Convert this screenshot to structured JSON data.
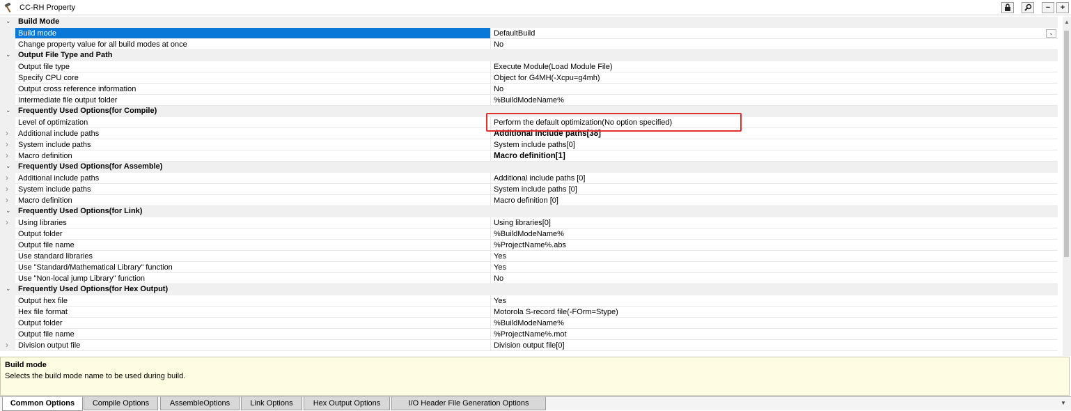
{
  "window": {
    "title": "CC-RH Property",
    "buttons": [
      "lock-icon",
      "search-icon",
      "minus-icon",
      "plus-icon"
    ]
  },
  "rows": [
    {
      "type": "category",
      "label": "Build Mode"
    },
    {
      "type": "property",
      "name": "Build mode",
      "value": "DefaultBuild",
      "selected": true,
      "dropdown": true
    },
    {
      "type": "property",
      "name": "Change property value for all build modes at once",
      "value": "No"
    },
    {
      "type": "category",
      "label": "Output File Type and Path"
    },
    {
      "type": "property",
      "name": "Output file type",
      "value": "Execute Module(Load Module File)"
    },
    {
      "type": "property",
      "name": "Specify CPU core",
      "value": "Object for G4MH(-Xcpu=g4mh)"
    },
    {
      "type": "property",
      "name": "Output cross reference information",
      "value": "No"
    },
    {
      "type": "property",
      "name": "Intermediate file output folder",
      "value": "%BuildModeName%"
    },
    {
      "type": "category",
      "label": "Frequently Used Options(for Compile)"
    },
    {
      "type": "property",
      "name": "Level of optimization",
      "value": "Perform the default optimization(No option specified)",
      "highlighted": true
    },
    {
      "type": "property",
      "name": "Additional include paths",
      "value": "Additional include paths[38]",
      "expandable": true,
      "bold": true
    },
    {
      "type": "property",
      "name": "System include paths",
      "value": "System include paths[0]",
      "expandable": true
    },
    {
      "type": "property",
      "name": "Macro definition",
      "value": "Macro definition[1]",
      "expandable": true,
      "bold": true
    },
    {
      "type": "category",
      "label": "Frequently Used Options(for Assemble)"
    },
    {
      "type": "property",
      "name": "Additional include paths",
      "value": "Additional include paths [0]",
      "expandable": true
    },
    {
      "type": "property",
      "name": "System include paths",
      "value": "System include paths [0]",
      "expandable": true
    },
    {
      "type": "property",
      "name": "Macro definition",
      "value": "Macro definition [0]",
      "expandable": true
    },
    {
      "type": "category",
      "label": "Frequently Used Options(for Link)"
    },
    {
      "type": "property",
      "name": "Using libraries",
      "value": "Using libraries[0]",
      "expandable": true
    },
    {
      "type": "property",
      "name": "Output folder",
      "value": "%BuildModeName%"
    },
    {
      "type": "property",
      "name": "Output file name",
      "value": "%ProjectName%.abs"
    },
    {
      "type": "property",
      "name": "Use standard libraries",
      "value": "Yes"
    },
    {
      "type": "property",
      "name": "Use \"Standard/Mathematical Library\" function",
      "value": "Yes"
    },
    {
      "type": "property",
      "name": "Use \"Non-local jump Library\" function",
      "value": "No"
    },
    {
      "type": "category",
      "label": "Frequently Used Options(for Hex Output)"
    },
    {
      "type": "property",
      "name": "Output hex file",
      "value": "Yes"
    },
    {
      "type": "property",
      "name": "Hex file format",
      "value": "Motorola S-record file(-FOrm=Stype)"
    },
    {
      "type": "property",
      "name": "Output folder",
      "value": "%BuildModeName%"
    },
    {
      "type": "property",
      "name": "Output file name",
      "value": "%ProjectName%.mot"
    },
    {
      "type": "property",
      "name": "Division output file",
      "value": "Division output file[0]",
      "expandable": true
    }
  ],
  "description": {
    "title": "Build mode",
    "text": "Selects the build mode name to be used during build."
  },
  "tabs": [
    {
      "label": "Common Options",
      "active": true
    },
    {
      "label": "Compile Options"
    },
    {
      "label": "AssembleOptions"
    },
    {
      "label": "Link Options"
    },
    {
      "label": "Hex Output Options"
    },
    {
      "label": "I/O Header File Generation Options"
    }
  ],
  "colors": {
    "selection": "#0a78d7",
    "category_bg": "#f0f0f0",
    "description_bg": "#fffde1",
    "highlight_border": "#e03131"
  }
}
